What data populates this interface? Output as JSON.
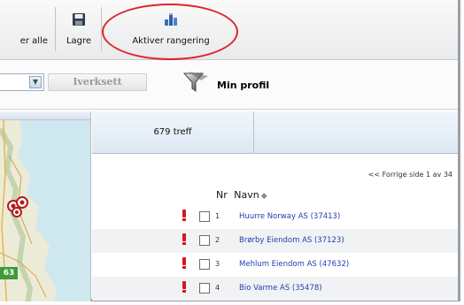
{
  "toolbar": {
    "items": [
      {
        "label": "er alle"
      },
      {
        "label": "Lagre",
        "icon": "save-icon"
      },
      {
        "label": "Aktiver rangering",
        "icon": "ranking-icon"
      }
    ],
    "highlight_color": "#e0242a"
  },
  "filter": {
    "apply_label": "Iverksett",
    "profile_label": "Min profil"
  },
  "map": {
    "road_badge": "63"
  },
  "results": {
    "hits_label": "679 treff",
    "pager_text": "<< Forrige side  1 av 34",
    "columns": {
      "nr": "Nr",
      "name": "Navn"
    },
    "rows": [
      {
        "nr": "1",
        "name": "Huurre Norway AS (37413)"
      },
      {
        "nr": "2",
        "name": "Brørby Eiendom AS (37123)"
      },
      {
        "nr": "3",
        "name": "Mehlum Eiendom AS (47632)"
      },
      {
        "nr": "4",
        "name": "Bio Varme AS (35478)"
      }
    ],
    "link_color": "#1f3fb0",
    "warning_color": "#d8161b"
  }
}
